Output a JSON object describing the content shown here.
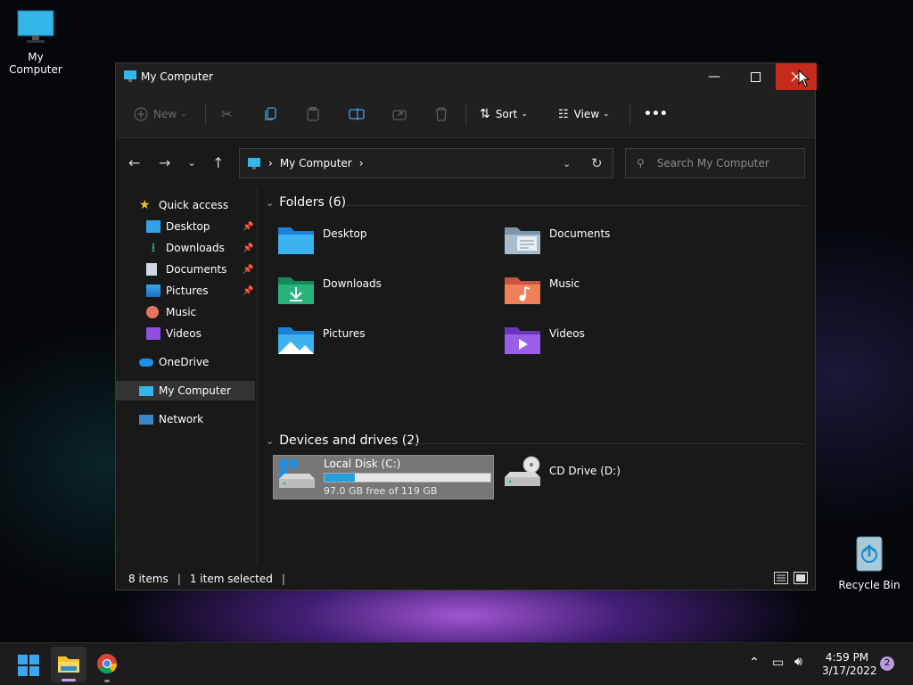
{
  "desktop": {
    "my_computer_label": "My Computer",
    "recycle_bin_label": "Recycle Bin"
  },
  "window": {
    "title": "My Computer",
    "toolbar": {
      "new_label": "New",
      "sort_label": "Sort",
      "view_label": "View",
      "more_label": "•••"
    },
    "address": {
      "segment": "My Computer"
    },
    "search": {
      "placeholder": "Search My Computer"
    },
    "sidebar": {
      "quick_access": "Quick access",
      "items": [
        {
          "label": "Desktop",
          "pinned": true
        },
        {
          "label": "Downloads",
          "pinned": true
        },
        {
          "label": "Documents",
          "pinned": true
        },
        {
          "label": "Pictures",
          "pinned": true
        },
        {
          "label": "Music",
          "pinned": false
        },
        {
          "label": "Videos",
          "pinned": false
        }
      ],
      "onedrive": "OneDrive",
      "my_computer": "My Computer",
      "network": "Network"
    },
    "content": {
      "folders_header": "Folders (6)",
      "folders": [
        "Desktop",
        "Documents",
        "Downloads",
        "Music",
        "Pictures",
        "Videos"
      ],
      "devices_header": "Devices and drives (2)",
      "drives": [
        {
          "name": "Local Disk (C:)",
          "free": "97.0 GB free of 119 GB",
          "used_fraction": 0.185
        },
        {
          "name": "CD Drive (D:)"
        }
      ]
    },
    "status": {
      "items": "8 items",
      "selected": "1 item selected"
    }
  },
  "taskbar": {
    "time": "4:59 PM",
    "date": "3/17/2022",
    "notification_count": "2"
  },
  "colors": {
    "accent": "#26a0da",
    "close_red": "#c42b1c"
  }
}
